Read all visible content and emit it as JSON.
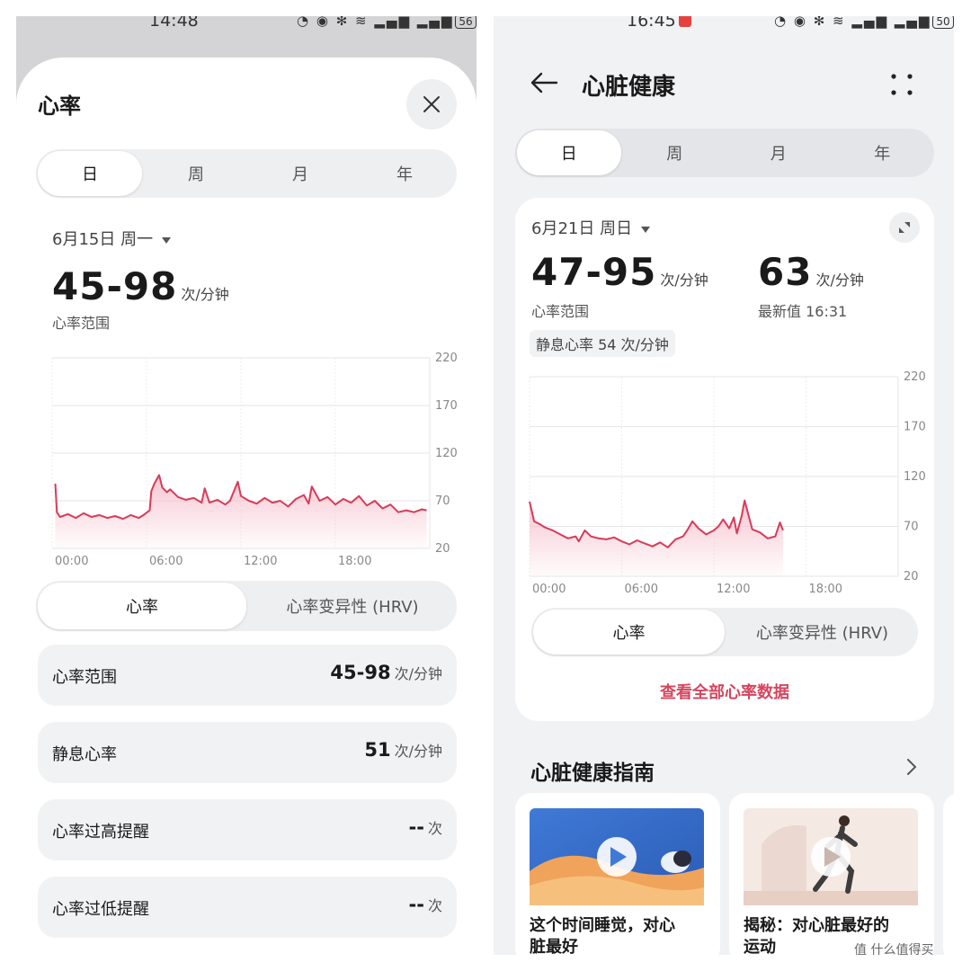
{
  "left": {
    "status": {
      "time": "14:48",
      "icons": "◔ ◉ ✻ ≋ ▂▄▆ ▂▄▆",
      "battery": "56"
    },
    "title": "心率",
    "tabs": [
      "日",
      "周",
      "月",
      "年"
    ],
    "active_tab": "日",
    "date": "6月15日 周一",
    "range_value": "45-98",
    "range_unit": "次/分钟",
    "range_label": "心率范围",
    "toggle": [
      "心率",
      "心率变异性 (HRV)"
    ],
    "stats": [
      {
        "label": "心率范围",
        "value": "45-98",
        "unit": "次/分钟"
      },
      {
        "label": "静息心率",
        "value": "51",
        "unit": "次/分钟"
      },
      {
        "label": "心率过高提醒",
        "value": "--",
        "unit": "次"
      },
      {
        "label": "心率过低提醒",
        "value": "--",
        "unit": "次"
      }
    ]
  },
  "right": {
    "status": {
      "time": "16:45",
      "icons": "◔ ◉ ✻ ≋ ▂▄▆ ▂▄▆",
      "battery": "50"
    },
    "title": "心脏健康",
    "tabs": [
      "日",
      "周",
      "月",
      "年"
    ],
    "active_tab": "日",
    "date": "6月21日 周日",
    "range_value": "47-95",
    "range_unit": "次/分钟",
    "range_label": "心率范围",
    "latest_value": "63",
    "latest_unit": "次/分钟",
    "latest_label": "最新值 16:31",
    "resting_tag": "静息心率 54 次/分钟",
    "toggle": [
      "心率",
      "心率变异性 (HRV)"
    ],
    "view_all": "查看全部心率数据",
    "guide_title": "心脏健康指南",
    "guides": [
      {
        "title_line1": "这个时间睡觉，对心",
        "title_line2": "脏最好"
      },
      {
        "title_line1": "揭秘：对心脏最好的",
        "title_line2": "运动"
      }
    ]
  },
  "watermark": "值 什么值得买",
  "colors": {
    "accent": "#d6455e",
    "line": "#d83b5a",
    "fill": "#f6c3ce"
  },
  "chart_data": [
    {
      "type": "area",
      "title": "",
      "xlabel": "",
      "ylabel": "",
      "xticks": [
        "00:00",
        "06:00",
        "12:00",
        "18:00"
      ],
      "yticks": [
        20,
        70,
        120,
        170,
        220
      ],
      "ylim": [
        20,
        220
      ],
      "xlim_hours": [
        0,
        24
      ],
      "grid": true,
      "series": [
        {
          "x": [
            0.2,
            0.3,
            0.5,
            1,
            1.5,
            2,
            2.5,
            3,
            3.5,
            4,
            4.5,
            5,
            5.5,
            5.8,
            6.2,
            6.3,
            6.5,
            6.8,
            7,
            7.3,
            7.5,
            8,
            8.5,
            9,
            9.5,
            9.7,
            10,
            10.5,
            11,
            11.3,
            11.5,
            11.8,
            12,
            12.5,
            13,
            13.5,
            14,
            14.5,
            15,
            15.5,
            16,
            16.3,
            16.5,
            17,
            17.5,
            18,
            18.5,
            19,
            19.5,
            20,
            20.5,
            21,
            21.5,
            22,
            22.5,
            23,
            23.5,
            23.8
          ],
          "y": [
            88,
            58,
            53,
            56,
            52,
            57,
            53,
            55,
            52,
            54,
            51,
            55,
            52,
            55,
            60,
            80,
            88,
            97,
            84,
            79,
            82,
            74,
            71,
            73,
            68,
            83,
            68,
            71,
            66,
            70,
            78,
            90,
            75,
            70,
            67,
            73,
            68,
            70,
            64,
            72,
            76,
            67,
            85,
            70,
            74,
            66,
            72,
            68,
            75,
            65,
            70,
            62,
            66,
            58,
            60,
            58,
            61,
            60
          ]
        }
      ]
    },
    {
      "type": "area",
      "title": "",
      "xlabel": "",
      "ylabel": "",
      "xticks": [
        "00:00",
        "06:00",
        "12:00",
        "18:00"
      ],
      "yticks": [
        20,
        70,
        120,
        170,
        220
      ],
      "ylim": [
        20,
        220
      ],
      "xlim_hours": [
        0,
        24
      ],
      "grid": true,
      "series": [
        {
          "x": [
            0,
            0.3,
            0.7,
            1,
            1.5,
            2,
            2.5,
            3,
            3.2,
            3.6,
            4,
            4.5,
            5,
            5.5,
            6,
            6.5,
            7,
            7.5,
            8,
            8.5,
            9,
            9.5,
            10,
            10.3,
            10.6,
            11,
            11.5,
            12,
            12.3,
            12.6,
            13,
            13.3,
            13.5,
            13.8,
            14,
            14.5,
            15,
            15.5,
            16,
            16.3,
            16.5
          ],
          "y": [
            95,
            75,
            72,
            69,
            66,
            62,
            58,
            60,
            55,
            66,
            60,
            58,
            57,
            59,
            55,
            52,
            56,
            53,
            50,
            54,
            49,
            57,
            60,
            67,
            75,
            68,
            62,
            66,
            70,
            77,
            68,
            79,
            63,
            80,
            96,
            67,
            64,
            58,
            60,
            74,
            66
          ]
        }
      ]
    }
  ]
}
